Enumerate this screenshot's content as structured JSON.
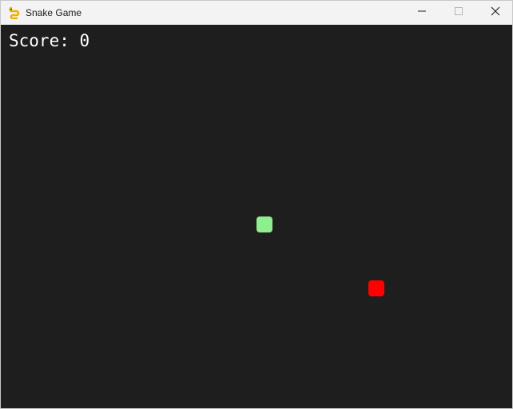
{
  "window": {
    "title": "Snake Game"
  },
  "titlebar": {
    "app_icon": "snake-app-icon",
    "minimize_icon": "minimize-icon",
    "maximize_icon": "maximize-icon",
    "close_icon": "close-icon"
  },
  "game": {
    "score_text": "Score: 0",
    "background": "#1e1e1e",
    "snake_color": "#90ee90",
    "food_color": "#ff0000"
  }
}
